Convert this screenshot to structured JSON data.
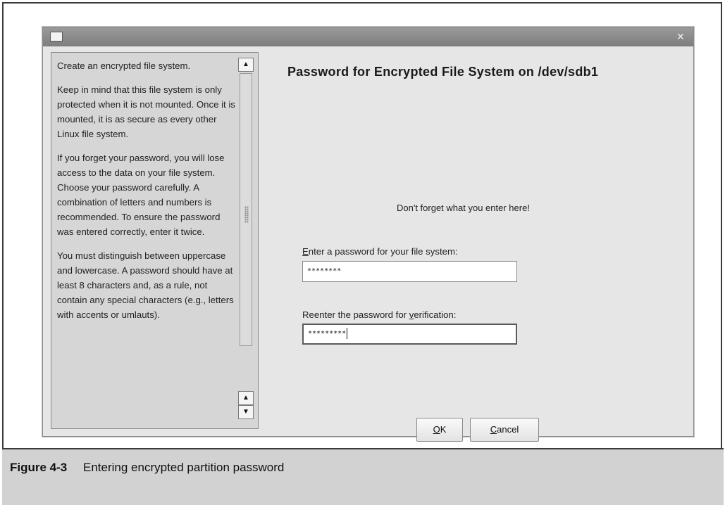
{
  "window": {
    "close_glyph": "×"
  },
  "help": {
    "paragraphs": [
      "Create an encrypted file system.",
      "Keep in mind that this file system is only protected when it is not mounted. Once it is mounted, it is as secure as every other Linux file system.",
      "If you forget your password, you will lose access to the data on your file system. Choose your password carefully. A combination of letters and numbers is recommended. To ensure the password was entered correctly, enter it twice.",
      "You must distinguish between uppercase and lowercase. A password should have at least 8 characters and, as a rule, not contain any special characters (e.g., letters with accents or umlauts)."
    ]
  },
  "dialog": {
    "title": "Password for Encrypted File System on /dev/sdb1",
    "warning": "Don't forget what you enter here!",
    "password_label": {
      "mnemonic": "E",
      "rest": "nter a password for your file system:"
    },
    "verify_label": {
      "before": "Reenter the password for ",
      "mnemonic": "v",
      "after": "erification:"
    },
    "password_value": "********",
    "verify_value": "*********",
    "ok_label": {
      "mnemonic": "O",
      "rest": "K"
    },
    "cancel_label": {
      "mnemonic": "C",
      "rest": "ancel"
    }
  },
  "caption": {
    "number": "Figure 4-3",
    "text": "Entering encrypted partition password"
  }
}
